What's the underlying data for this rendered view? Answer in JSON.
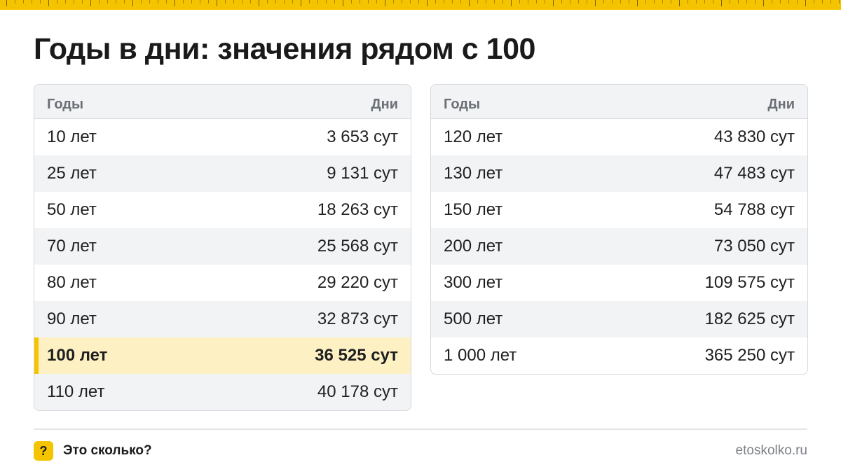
{
  "title": "Годы в дни: значения рядом с 100",
  "accent_color": "#f5c400",
  "highlight_color": "#fdf1c4",
  "tables": [
    {
      "headers": [
        "Годы",
        "Дни"
      ],
      "rows": [
        {
          "years": "10 лет",
          "days": "3 653 сут",
          "highlight": false
        },
        {
          "years": "25 лет",
          "days": "9 131 сут",
          "highlight": false
        },
        {
          "years": "50 лет",
          "days": "18 263 сут",
          "highlight": false
        },
        {
          "years": "70 лет",
          "days": "25 568 сут",
          "highlight": false
        },
        {
          "years": "80 лет",
          "days": "29 220 сут",
          "highlight": false
        },
        {
          "years": "90 лет",
          "days": "32 873 сут",
          "highlight": false
        },
        {
          "years": "100 лет",
          "days": "36 525 сут",
          "highlight": true
        },
        {
          "years": "110 лет",
          "days": "40 178 сут",
          "highlight": false
        }
      ]
    },
    {
      "headers": [
        "Годы",
        "Дни"
      ],
      "rows": [
        {
          "years": "120 лет",
          "days": "43 830 сут",
          "highlight": false
        },
        {
          "years": "130 лет",
          "days": "47 483 сут",
          "highlight": false
        },
        {
          "years": "150 лет",
          "days": "54 788 сут",
          "highlight": false
        },
        {
          "years": "200 лет",
          "days": "73 050 сут",
          "highlight": false
        },
        {
          "years": "300 лет",
          "days": "109 575 сут",
          "highlight": false
        },
        {
          "years": "500 лет",
          "days": "182 625 сут",
          "highlight": false
        },
        {
          "years": "1 000 лет",
          "days": "365 250 сут",
          "highlight": false
        }
      ]
    }
  ],
  "footer": {
    "badge": "?",
    "brand": "Это сколько?",
    "site": "etoskolko.ru"
  }
}
